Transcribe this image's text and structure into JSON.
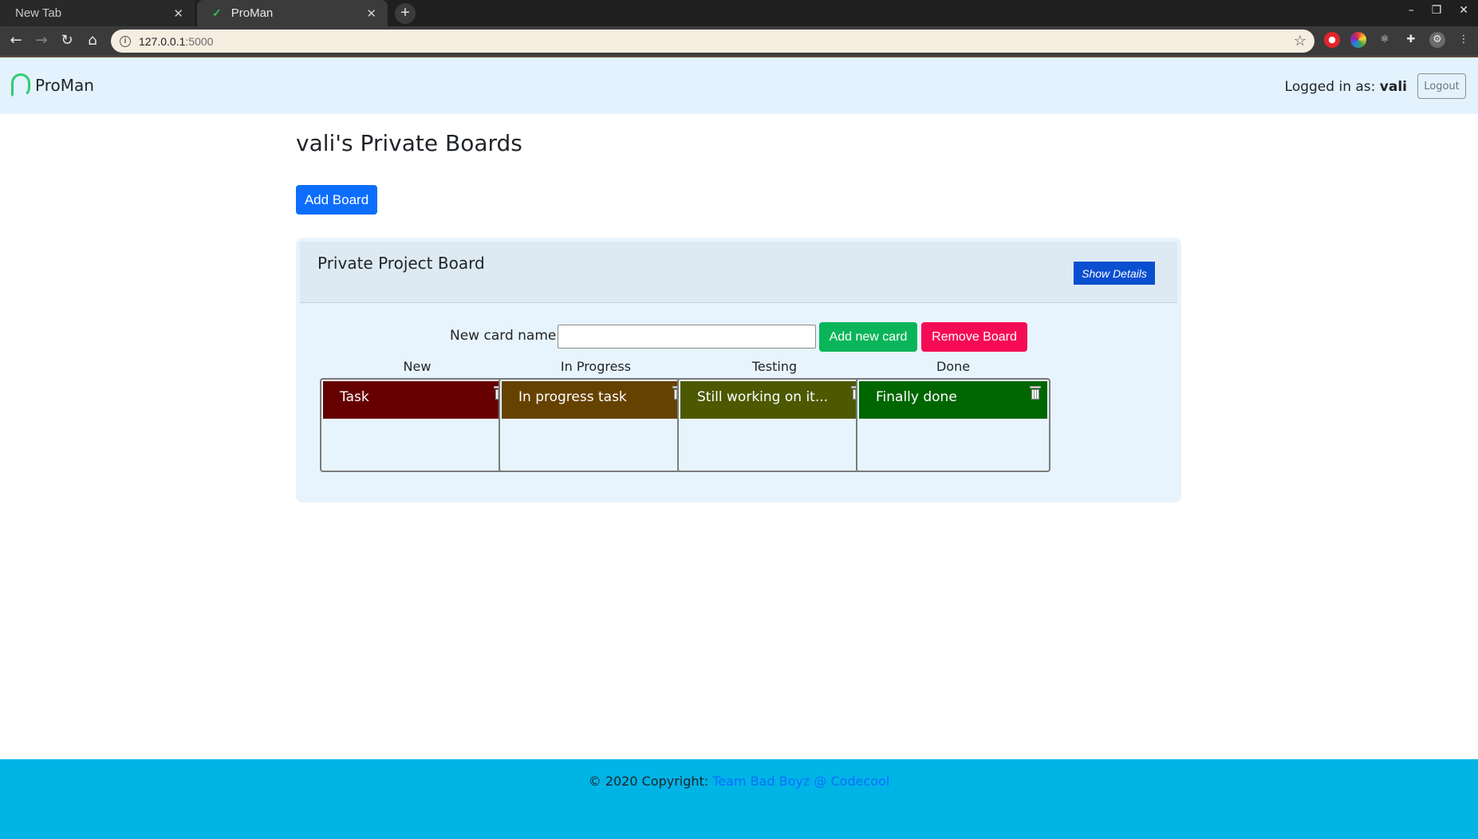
{
  "browser": {
    "tabs": [
      {
        "label": "New Tab",
        "active": false
      },
      {
        "label": "ProMan",
        "active": true
      }
    ],
    "url_host": "127.0.0.1",
    "url_port": ":5000"
  },
  "header": {
    "brand": "ProMan",
    "logged_in_label": "Logged in as:",
    "username": "vali",
    "logout_label": "Logout"
  },
  "page": {
    "title": "vali's Private Boards",
    "add_board_label": "Add Board"
  },
  "board": {
    "title": "Private Project Board",
    "show_details_label": "Show Details",
    "new_card_label": "New card name:",
    "new_card_value": "",
    "add_card_label": "Add new card",
    "remove_board_label": "Remove Board",
    "columns": [
      {
        "title": "New",
        "cards": [
          {
            "title": "Task",
            "color": "#660000"
          }
        ]
      },
      {
        "title": "In Progress",
        "cards": [
          {
            "title": "In progress task",
            "color": "#664200"
          }
        ]
      },
      {
        "title": "Testing",
        "cards": [
          {
            "title": "Still working on it...",
            "color": "#4d5900"
          }
        ]
      },
      {
        "title": "Done",
        "cards": [
          {
            "title": "Finally done",
            "color": "#006600"
          }
        ]
      }
    ]
  },
  "footer": {
    "copyright": "© 2020 Copyright: ",
    "link_text": "Team Bad Boyz @ Codecool"
  },
  "colors": {
    "navbar_bg": "#e3f2fd",
    "footer_bg": "#00b4e6",
    "primary": "#0d6efd",
    "success": "#0ab55a",
    "danger": "#f50b55"
  }
}
